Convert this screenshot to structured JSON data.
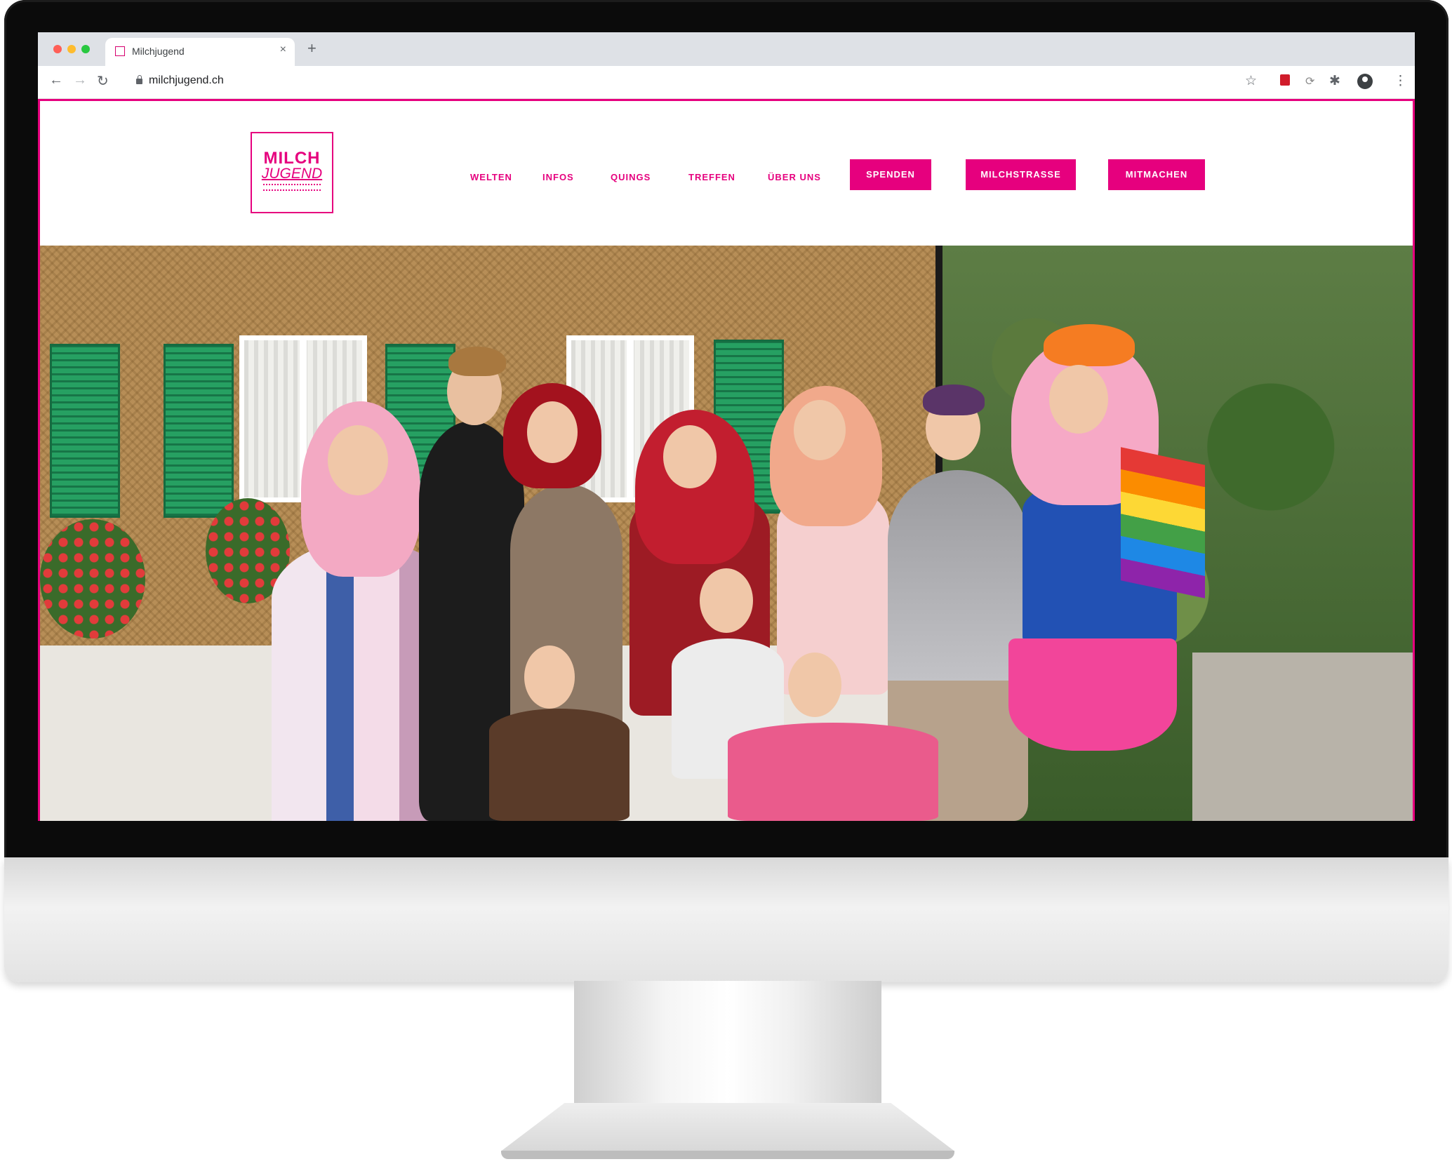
{
  "browser": {
    "tab_title": "Milchjugend",
    "tab_close": "×",
    "new_tab": "+",
    "url": "milchjugend.ch",
    "icons": [
      "back-icon",
      "forward-icon",
      "reload-icon",
      "lock-icon",
      "star-icon",
      "extension-icon",
      "extension-icon",
      "puzzle-icon",
      "account-icon",
      "menu-icon"
    ]
  },
  "site": {
    "logo": {
      "line1": "MILCH",
      "line2": "JUGEND"
    },
    "nav": {
      "links": [
        "WELTEN",
        "INFOS",
        "QUINGS",
        "TREFFEN",
        "ÜBER UNS"
      ],
      "buttons": [
        "SPENDEN",
        "MILCHSTRASSE",
        "MITMACHEN"
      ]
    },
    "colors": {
      "brand": "#e6007e",
      "shutter": "#1f8c56"
    }
  }
}
